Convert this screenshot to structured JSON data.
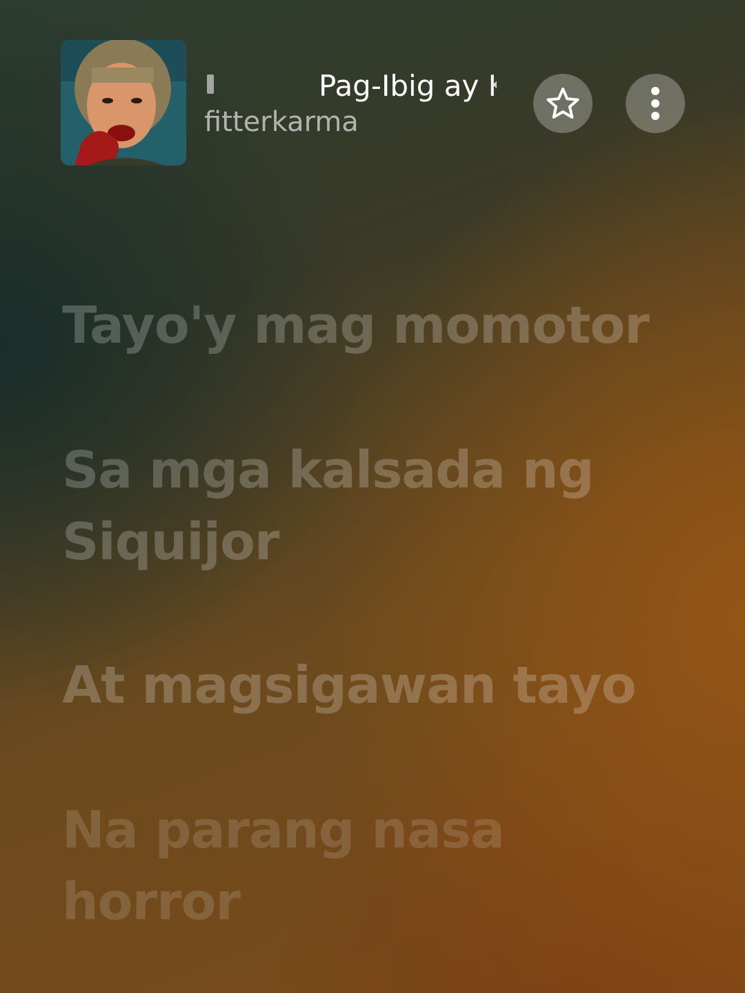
{
  "header": {
    "track_title": "Pag-Ibig ay K",
    "artist": "fitterkarma",
    "favorite_icon": "star-icon",
    "more_icon": "more-vertical-icon"
  },
  "lyrics": [
    "Tayo'y mag momotor",
    "Sa mga kalsada ng Siquijor",
    "At magsigawan tayo",
    "Na parang nasa horror"
  ]
}
